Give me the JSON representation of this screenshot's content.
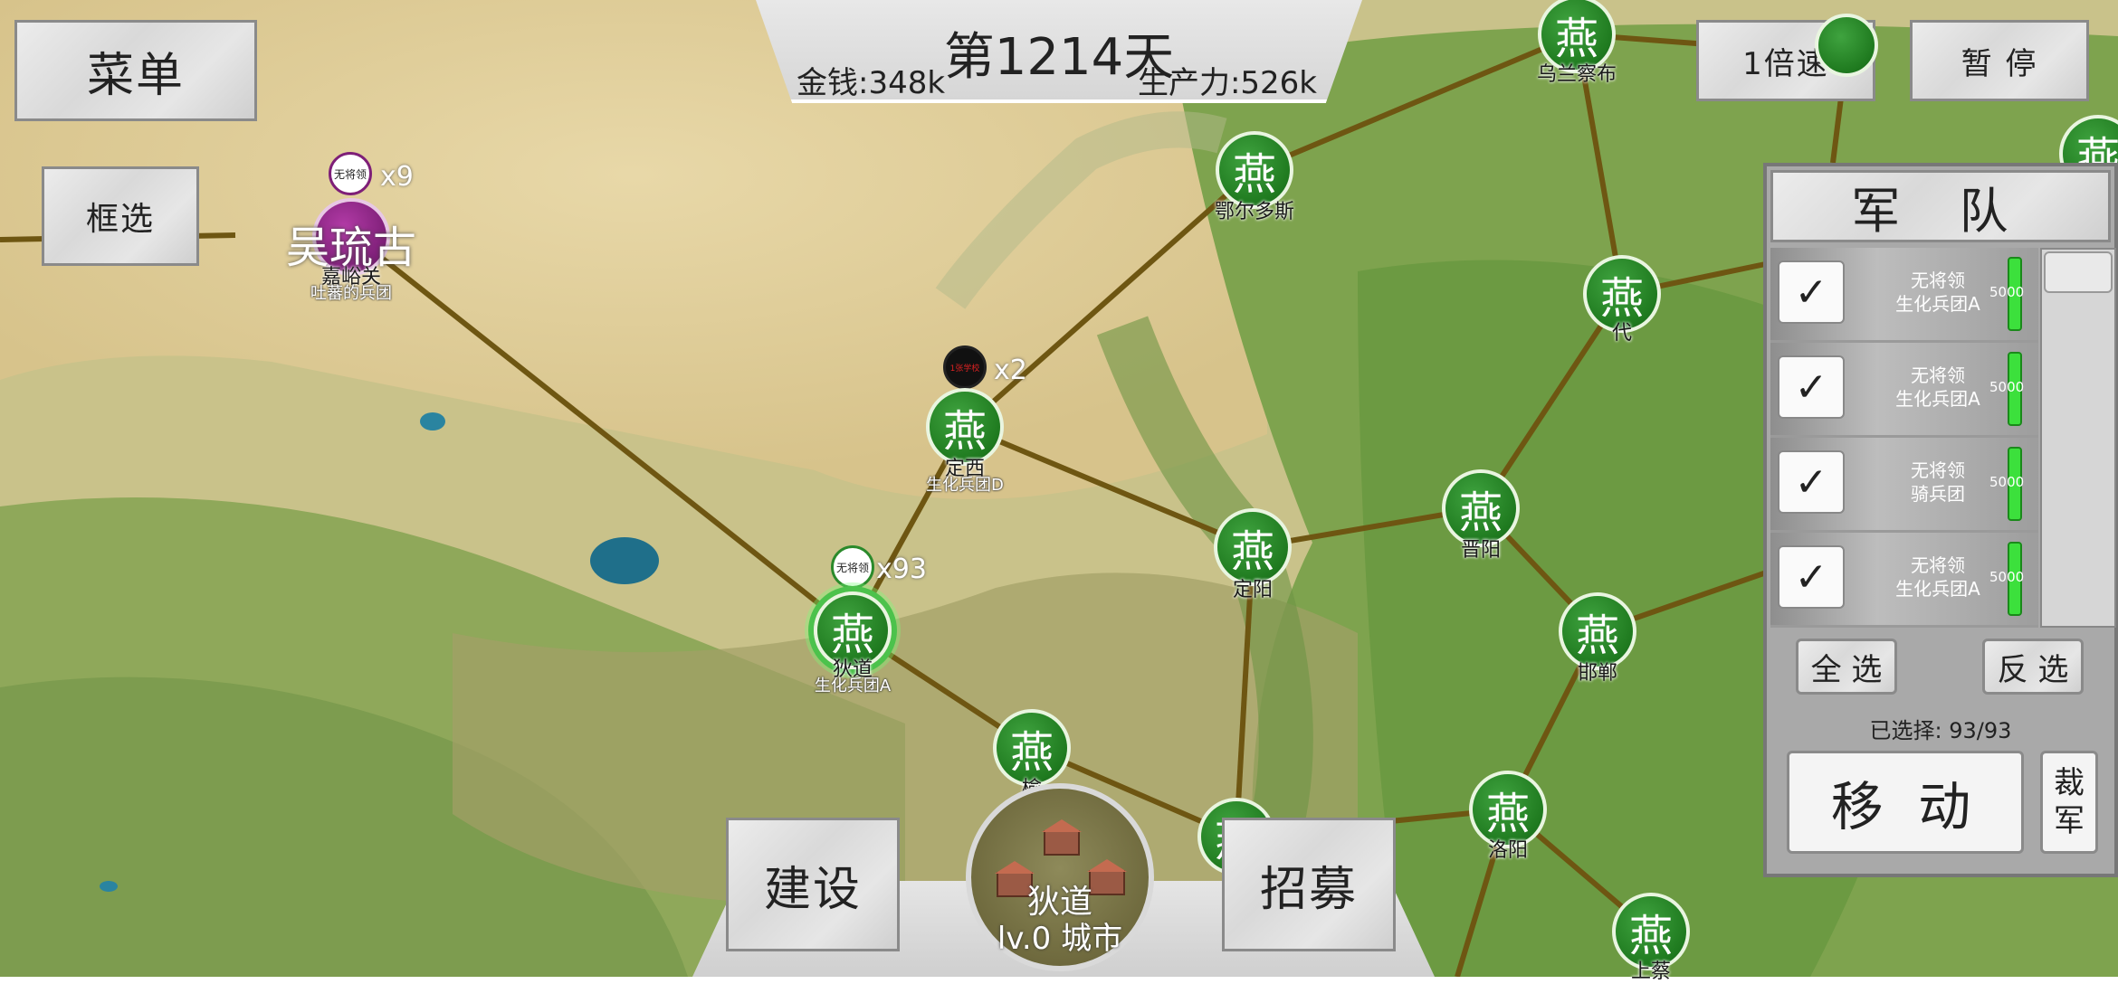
{
  "hud": {
    "day": "第1214天",
    "money": "金钱:348k",
    "production": "生产力:526k",
    "menu": "菜单",
    "box_select": "框选",
    "speed": "1倍速",
    "pause": "暂 停"
  },
  "map": {
    "faction_char": "燕",
    "enemy_name": "吴琉古",
    "cities": {
      "jiayuguan": "嘉峪关",
      "dingxi": "定西",
      "didao": "狄道",
      "dingyang": "定阳",
      "jinyang": "晋阳",
      "handan": "邯郸",
      "luoyang": "洛阳",
      "shangcai": "上蔡",
      "dai": "代",
      "ordos": "鄂尔多斯",
      "ulanqab": "乌兰察布",
      "partial1": "榆"
    },
    "army_labels": {
      "didao": "生化兵团A",
      "dingxi": "生化兵团D",
      "jiayuguan": "吐蕃的兵团"
    },
    "badges": {
      "no_general": "无将领",
      "dark_badge": "1张学校"
    },
    "multipliers": {
      "jiayuguan": "x9",
      "dingxi": "x2",
      "didao": "x93"
    }
  },
  "army_panel": {
    "title": "军 队",
    "check": "✓",
    "rows": [
      {
        "general": "无将领",
        "unit": "生化兵团A",
        "count": "5000"
      },
      {
        "general": "无将领",
        "unit": "生化兵团A",
        "count": "5000"
      },
      {
        "general": "无将领",
        "unit": "骑兵团",
        "count": "5000"
      },
      {
        "general": "无将领",
        "unit": "生化兵团A",
        "count": "5000"
      }
    ],
    "select_all": "全 选",
    "invert": "反 选",
    "selected": "已选择: 93/93",
    "move": "移 动",
    "cut": "裁军"
  },
  "bottom": {
    "build": "建设",
    "recruit": "招募",
    "city_name": "狄道",
    "city_level": "lv.0 城市"
  }
}
